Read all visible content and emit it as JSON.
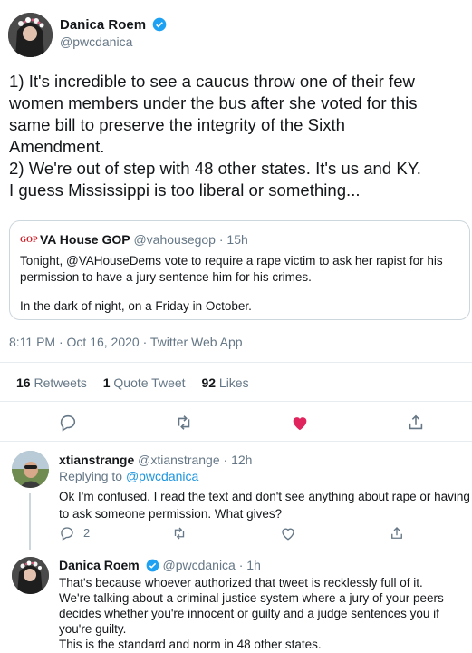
{
  "main_tweet": {
    "author_name": "Danica Roem",
    "author_handle": "@pwcdanica",
    "text_lines": [
      "1) It's incredible to see a caucus throw one of their few",
      "women members under the bus after she voted for this",
      "same bill to preserve the integrity of the Sixth",
      "Amendment.",
      "2) We're out of step with 48 other states. It's us and KY.",
      "I guess Mississippi is too liberal or something..."
    ],
    "meta": "8:11 PM · Oct 16, 2020 · Twitter Web App",
    "stats": {
      "retweets_count": "16",
      "retweets_label": "Retweets",
      "quotes_count": "1",
      "quotes_label": "Quote Tweet",
      "likes_count": "92",
      "likes_label": "Likes"
    }
  },
  "quoted_tweet": {
    "logo_text": "GOP",
    "author_name": "VA House GOP",
    "author_handle": "@vahousegop",
    "time": "· 15h",
    "text_line1": "Tonight, @VAHouseDems vote to require a rape victim to ask her rapist for his",
    "text_line2": "permission to have a jury sentence him for his crimes.",
    "text_line3": "In the dark of night, on a Friday in October."
  },
  "reply1": {
    "author_name": "xtianstrange",
    "author_handle": "@xtianstrange",
    "time": "· 12h",
    "replying_prefix": "Replying to",
    "replying_handle": "@pwcdanica",
    "text_line1": "Ok I'm confused. I read the text and don't see anything about rape or having",
    "text_line2": "to ask someone permission. What gives?",
    "reply_count": "2"
  },
  "reply2": {
    "author_name": "Danica Roem",
    "author_handle": "@pwcdanica",
    "time": "· 1h",
    "text_lines": [
      "That's because whoever authorized that tweet is recklessly full of it.",
      "We're talking about a criminal justice system where a jury of your peers",
      "decides whether you're innocent or guilty and a judge sentences you if",
      "you're guilty.",
      "This is the standard and norm in 48 other states."
    ]
  },
  "colors": {
    "accent": "#1b95e0",
    "like": "#e0245e",
    "muted": "#657786",
    "gop_red": "#d0202a"
  },
  "icons": [
    "verified-badge-icon",
    "reply-icon",
    "retweet-icon",
    "like-icon",
    "share-icon"
  ]
}
